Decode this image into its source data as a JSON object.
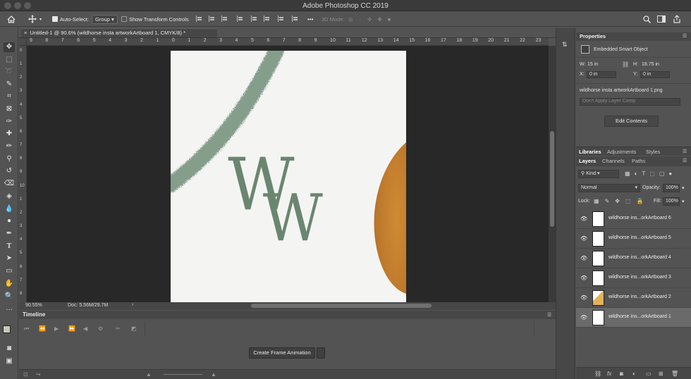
{
  "app": {
    "title": "Adobe Photoshop CC 2019"
  },
  "options_bar": {
    "auto_select_label": "Auto-Select:",
    "auto_select_value": "Group",
    "show_transform_label": "Show Transform Controls",
    "three_d_mode_label": "3D Mode:",
    "more_label": "•••"
  },
  "document": {
    "tab_title": "Untitled-1 @ 90.6% (wildhorse insta artworkArtboard 1, CMYK/8) *",
    "close_glyph": "×",
    "zoom": "90.55%",
    "doc_size": "Doc: 5.56M/29.7M"
  },
  "ruler": {
    "top": [
      "9",
      "8",
      "7",
      "6",
      "5",
      "4",
      "3",
      "2",
      "1",
      "0",
      "1",
      "2",
      "3",
      "4",
      "5",
      "6",
      "7",
      "8",
      "9",
      "10",
      "11",
      "12",
      "13",
      "14",
      "15",
      "16",
      "17",
      "18",
      "19",
      "20",
      "21",
      "22",
      "23"
    ],
    "left": [
      "0",
      "1",
      "2",
      "3",
      "4",
      "5",
      "6",
      "7",
      "8",
      "9",
      "10",
      "1",
      "2",
      "3",
      "4",
      "5",
      "6",
      "7",
      "8"
    ]
  },
  "artwork": {
    "monogram_1": "W",
    "monogram_2": "W",
    "brush_color": "#7f9a86",
    "monogram_color": "#6b8670",
    "orange_color": "#c9822f"
  },
  "timeline": {
    "title": "Timeline",
    "create_button": "Create Frame Animation"
  },
  "properties": {
    "title": "Properties",
    "object_type": "Embedded Smart Object",
    "w_label": "W:",
    "w_value": "15 in",
    "h_label": "H:",
    "h_value": "18.75 in",
    "x_label": "X:",
    "x_value": "0 in",
    "y_label": "Y:",
    "y_value": "0 in",
    "filename": "wildhorse insta artworkArtboard 1.png",
    "layer_comp": "Don't Apply Layer Comp",
    "edit_contents": "Edit Contents"
  },
  "panel_tabs": {
    "libraries": "Libraries",
    "adjustments": "Adjustments",
    "styles": "Styles",
    "layers": "Layers",
    "channels": "Channels",
    "paths": "Paths"
  },
  "layers_panel": {
    "filter_kind": "Kind",
    "blend_mode": "Normal",
    "opacity_label": "Opacity:",
    "opacity_value": "100%",
    "lock_label": "Lock:",
    "fill_label": "Fill:",
    "fill_value": "100%",
    "layers": [
      {
        "name": "wildhorse ins...orkArtboard 6"
      },
      {
        "name": "wildhorse ins...orkArtboard 5"
      },
      {
        "name": "wildhorse ins...orkArtboard 4"
      },
      {
        "name": "wildhorse ins...orkArtboard 3"
      },
      {
        "name": "wildhorse ins...orkArtboard 2"
      },
      {
        "name": "wildhorse ins...orkArtboard 1"
      }
    ]
  }
}
